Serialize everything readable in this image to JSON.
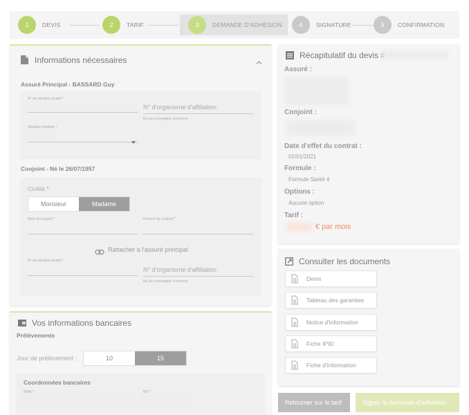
{
  "stepper": {
    "steps": [
      {
        "num": "1",
        "label": "DEVIS"
      },
      {
        "num": "2",
        "label": "TARIF"
      },
      {
        "num": "3",
        "label": "DEMANDE D'ADHÉSION"
      },
      {
        "num": "4",
        "label": "SIGNATURE"
      },
      {
        "num": "5",
        "label": "CONFIRMATION"
      }
    ]
  },
  "infos": {
    "title": "Informations nécessaires",
    "assure_heading": "Assuré Principal - BASSARD Guy",
    "nss_label": "N° de sécurité sociale *",
    "organisme_placeholder": "N° d'organisme d'affiliation",
    "organisme_hint": "Ne pas renseigner si inconnu",
    "situation_label": "Situation familiale *",
    "conjoint_heading": "Conjoint - Né le 26/07/1957",
    "civilite_label": "Civilité *",
    "civilite_options": [
      "Monsieur",
      "Madame"
    ],
    "nom_label": "Nom du conjoint *",
    "prenom_label": "Prénom du conjoint *",
    "rattacher_label": "Rattacher à l'assuré principal",
    "nss2_label": "N° de sécurité sociale *",
    "organisme2_placeholder": "N° d'organisme d'affiliation",
    "organisme2_hint": "Ne pas renseigner si inconnu"
  },
  "bank": {
    "title": "Vos informations bancaires",
    "prelevements": "Prélèvements",
    "jour_label": "Jour de prélèvement :",
    "jour_options": [
      "10",
      "15"
    ],
    "coord_heading": "Coordonnées bancaires",
    "iban_label": "IBAN *",
    "bic_label": "BIC *"
  },
  "recap": {
    "title": "Récapitulatif du devis #",
    "assure_label": "Assuré :",
    "conjoint_label": "Conjoint :",
    "date_label": "Date d'effet du contrat :",
    "date_value": "01/01/2021",
    "formule_label": "Formule :",
    "formule_value": "Formule Santé 4",
    "options_label": "Options :",
    "options_value": "Aucune option",
    "tarif_label": "Tarif :",
    "tarif_suffix": "€ par mois",
    "tarif_color": "#f08a6a"
  },
  "docs": {
    "title": "Consulter les documents",
    "items": [
      "Devis",
      "Tableau des garanties",
      "Notice d'information",
      "Fiche IPID",
      "Fiche d'information"
    ]
  },
  "footer": {
    "back_label": "Retourner sur le tarif",
    "next_label": "Signer la demande d'adhésion"
  },
  "colors": {
    "step_done": "#b9d56b",
    "step_todo": "#c9c9c9",
    "accent_green": "#d7e6a7"
  }
}
